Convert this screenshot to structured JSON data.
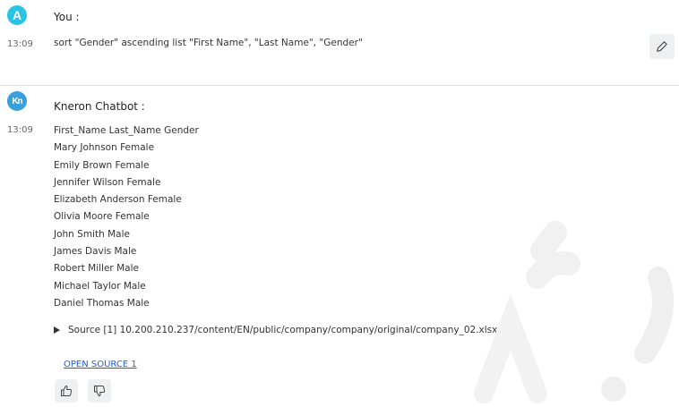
{
  "user_message": {
    "avatar_letter": "A",
    "sender": "You :",
    "time": "13:09",
    "text": "sort \"Gender\" ascending list \"First Name\", \"Last Name\", \"Gender\"",
    "edit_icon": "pencil-icon"
  },
  "bot_message": {
    "avatar_text": "Kn",
    "sender": "Kneron Chatbot :",
    "time": "13:09",
    "lines": [
      "First_Name Last_Name Gender",
      "Mary Johnson Female",
      "Emily Brown Female",
      "Jennifer Wilson Female",
      "Elizabeth Anderson Female",
      "Olivia Moore Female",
      "John Smith Male",
      "James Davis Male",
      "Robert Miller Male",
      "Michael Taylor Male",
      "Daniel Thomas Male"
    ],
    "source_text": "Source [1] 10.200.210.237/content/EN/public/company/company/original/company_02.xlsx",
    "open_source_label": "OPEN SOURCE 1",
    "feedback": {
      "like_icon": "thumbs-up-icon",
      "dislike_icon": "thumbs-down-icon"
    }
  },
  "colors": {
    "user_avatar": "#29c3e4",
    "bot_avatar": "#3aa0dc",
    "link": "#1f5fd6",
    "button_bg": "#eef0f2"
  }
}
